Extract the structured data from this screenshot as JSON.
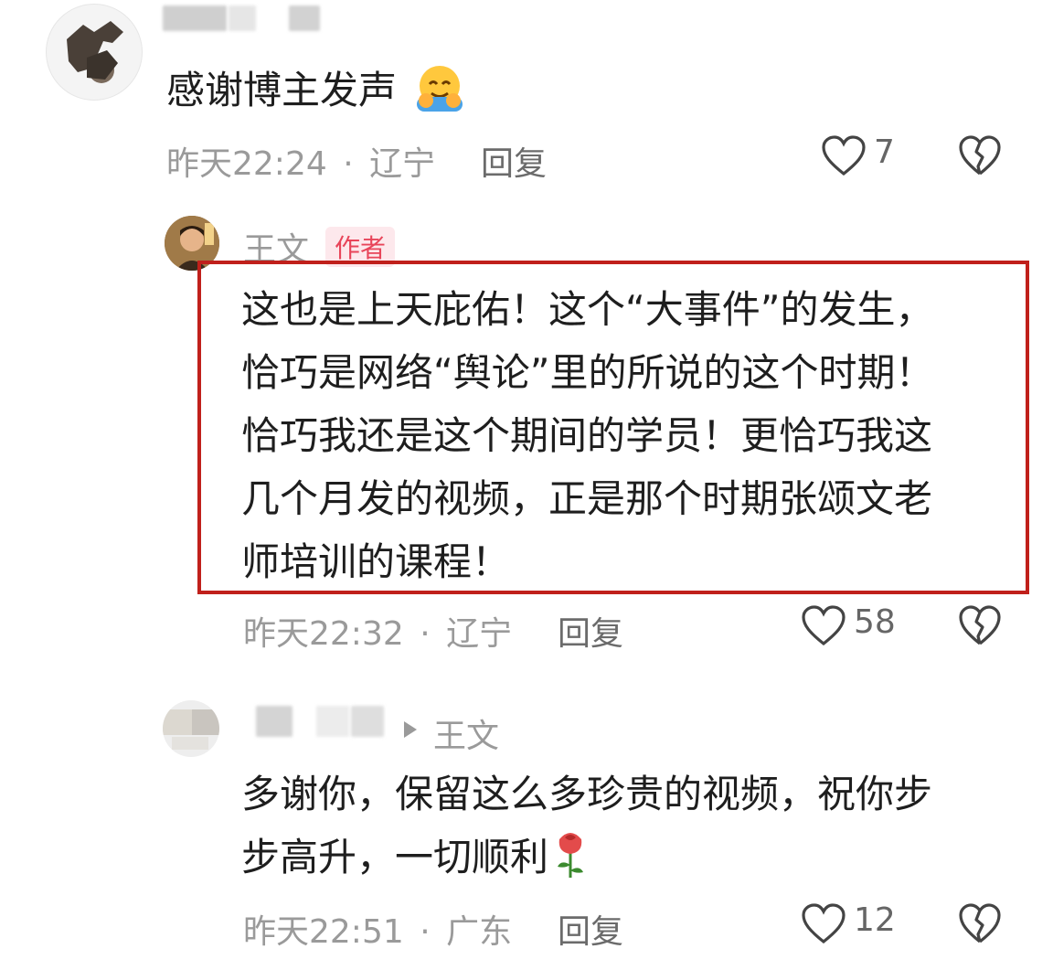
{
  "comments": [
    {
      "text": "感谢博主发声",
      "time": "昨天22:24",
      "location": "辽宁",
      "reply_label": "回复",
      "likes": "7",
      "emoji": "hug-emoji"
    },
    {
      "author": "王文",
      "author_badge": "作者",
      "text_lines": [
        "这也是上天庇佑！这个“大事件”的发生，",
        "恰巧是网络“舆论”里的所说的这个时期！",
        "恰巧我还是这个期间的学员！更恰巧我这",
        "几个月发的视频，正是那个时期张颂文老",
        "师培训的课程！"
      ],
      "time": "昨天22:32",
      "location": "辽宁",
      "reply_label": "回复",
      "likes": "58",
      "highlight_color": "#c0201b"
    },
    {
      "reply_to": "王文",
      "text_lines": [
        "多谢你，保留这么多珍贵的视频，祝你步",
        "步高升，一切顺利"
      ],
      "time": "昨天22:51",
      "location": "广东",
      "reply_label": "回复",
      "likes": "12",
      "emoji": "rose-emoji"
    }
  ],
  "separator": "·",
  "icons": {
    "like": "heart-outline-icon",
    "dislike": "broken-heart-icon",
    "reply_arrow": "triangle-right-icon"
  }
}
